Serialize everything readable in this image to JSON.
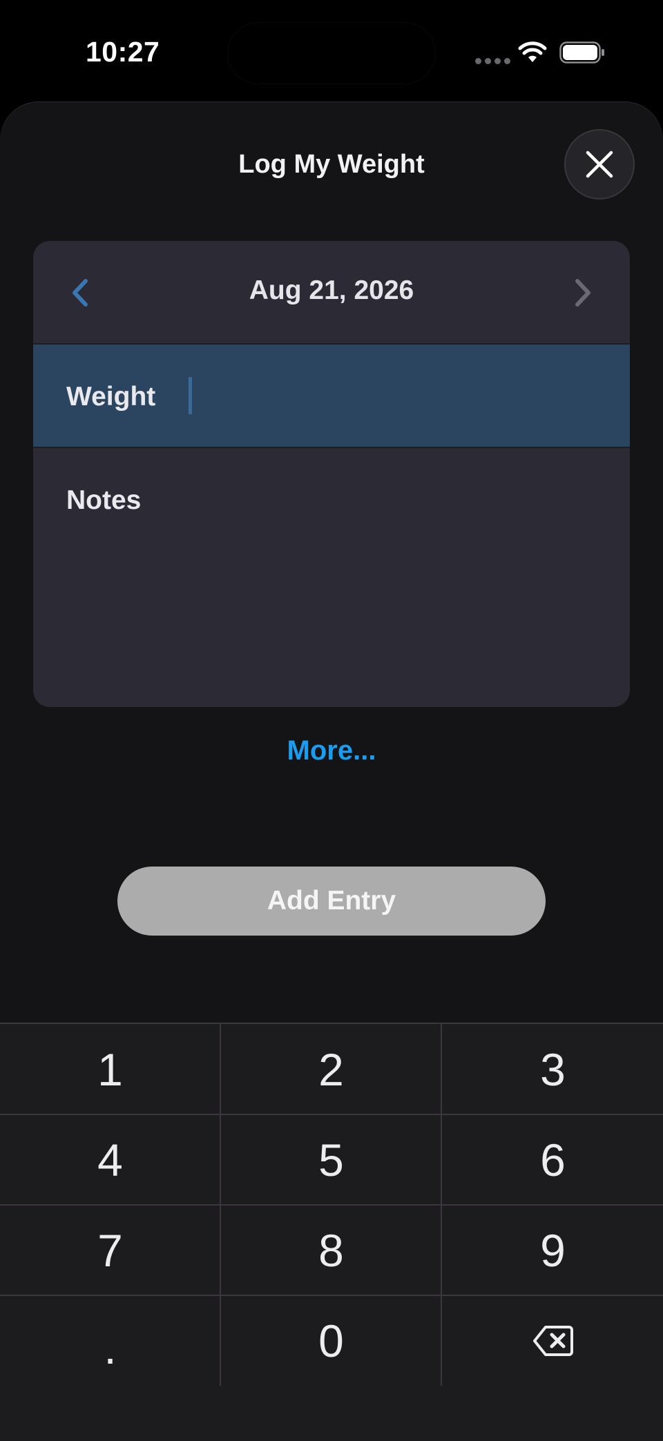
{
  "status_bar": {
    "time": "10:27"
  },
  "sheet": {
    "title": "Log My Weight",
    "close_icon": "close-icon"
  },
  "date_nav": {
    "date": "Aug 21, 2026",
    "prev_icon": "chevron-left-icon",
    "next_icon": "chevron-right-icon"
  },
  "form": {
    "weight_label": "Weight",
    "weight_value": "",
    "notes_label": "Notes"
  },
  "more_link": "More...",
  "add_entry_label": "Add Entry",
  "keypad": {
    "keys": [
      "1",
      "2",
      "3",
      "4",
      "5",
      "6",
      "7",
      "8",
      "9",
      ".",
      "0"
    ],
    "backspace_icon": "backspace-icon"
  },
  "colors": {
    "accent": "#1a9df0",
    "selected_row": "#2b4560",
    "card": "#2c2a35",
    "button_disabled": "#acacac"
  }
}
